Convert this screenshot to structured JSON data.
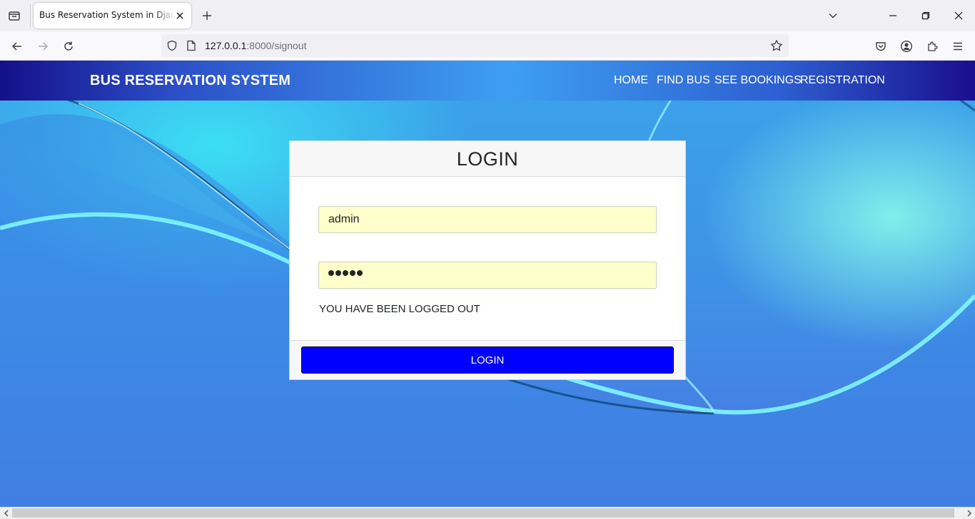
{
  "browser": {
    "tab_title": "Bus Reservation System in Django Project",
    "url_host": "127.0.0.1",
    "url_rest": ":8000/signout"
  },
  "site": {
    "brand": "BUS RESERVATION SYSTEM",
    "nav": [
      "HOME",
      "FIND BUS",
      "SEE BOOKINGS",
      "REGISTRATION"
    ]
  },
  "login": {
    "title": "LOGIN",
    "username_value": "admin",
    "password_length": 5,
    "message": "YOU HAVE BEEN LOGGED OUT",
    "button_label": "LOGIN"
  },
  "colors": {
    "button": "#0000ff",
    "field_bg": "#ffffcc",
    "header_dark": "#14108a",
    "header_light": "#3e9ff2"
  }
}
